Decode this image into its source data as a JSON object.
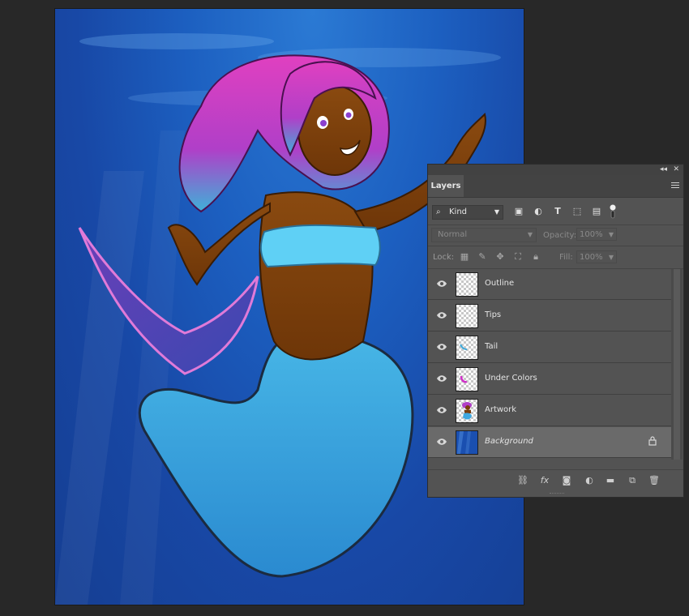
{
  "panel": {
    "collapse_icon": "double-chevron-left-icon",
    "close_icon": "close-icon",
    "tab_label": "Layers",
    "menu_icon": "panel-menu-icon"
  },
  "filter": {
    "kind_value": "Kind",
    "icons": [
      "pixel-layer-filter-icon",
      "adjustment-layer-filter-icon",
      "type-layer-filter-icon",
      "shape-layer-filter-icon",
      "smart-object-filter-icon",
      "filter-toggle-icon"
    ]
  },
  "blend": {
    "mode_value": "Normal",
    "opacity_label": "Opacity:",
    "opacity_value": "100%"
  },
  "lock": {
    "label": "Lock:",
    "icons": [
      "lock-transparent-pixels-icon",
      "lock-image-pixels-icon",
      "lock-position-icon",
      "lock-artboard-icon",
      "lock-all-icon"
    ],
    "fill_label": "Fill:",
    "fill_value": "100%"
  },
  "layers": [
    {
      "name": "Outline",
      "visible": true,
      "thumbnail": "transparent"
    },
    {
      "name": "Tips",
      "visible": true,
      "thumbnail": "transparent"
    },
    {
      "name": "Tail",
      "visible": true,
      "thumbnail": "tail-strokes"
    },
    {
      "name": "Under Colors",
      "visible": true,
      "thumbnail": "magenta-strokes"
    },
    {
      "name": "Artwork",
      "visible": true,
      "thumbnail": "mermaid-art"
    },
    {
      "name": "Background",
      "visible": true,
      "thumbnail": "blue-water",
      "locked": true,
      "selected": true
    }
  ],
  "bottom_bar": {
    "icons": [
      "link-layers-icon",
      "fx-icon",
      "add-mask-icon",
      "adjustment-layer-icon",
      "new-group-icon",
      "new-layer-icon",
      "delete-layer-icon"
    ],
    "fx_label": "fx"
  },
  "colors": {
    "panel_bg": "#535353",
    "workspace_bg": "#282828",
    "selected_row": "#6a6a6a",
    "water_blue": "#1c5fc0"
  }
}
